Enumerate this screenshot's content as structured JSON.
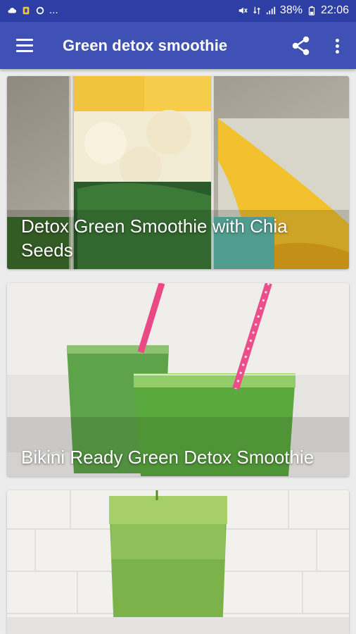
{
  "status_bar": {
    "left_dots": "...",
    "battery": "38%",
    "time": "22:06"
  },
  "app_bar": {
    "title": "Green detox smoothie",
    "menu_icon": "hamburger-menu-icon",
    "share_icon": "share-icon",
    "more_icon": "more-vert-icon"
  },
  "recipes": [
    {
      "title": "Detox Green Smoothie with Chia Seeds"
    },
    {
      "title": "Bikini Ready Green Detox Smoothie"
    },
    {
      "title": ""
    }
  ],
  "colors": {
    "status_bar": "#2d3ea5",
    "app_bar": "#3f51b5",
    "background": "#ececec"
  }
}
